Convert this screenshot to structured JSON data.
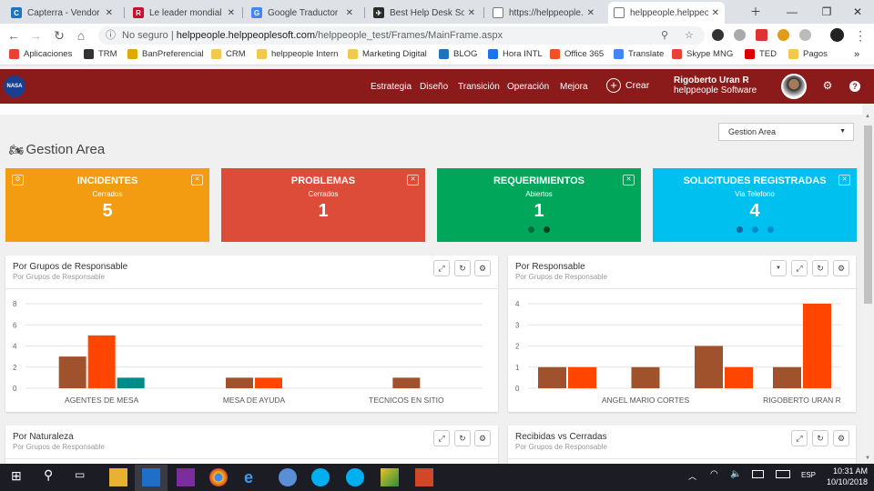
{
  "browser": {
    "tabs": [
      {
        "title": "Capterra - Vendor Po",
        "fav_color": "#1e73be",
        "fav_letter": "C"
      },
      {
        "title": "Le leader mondial de",
        "fav_color": "#c8102e",
        "fav_letter": "R"
      },
      {
        "title": "Google Traductor",
        "fav_color": "#4285f4",
        "fav_letter": "G"
      },
      {
        "title": "Best Help Desk Softw",
        "fav_color": "#2b2b2b",
        "fav_letter": "✈"
      },
      {
        "title": "https://helppeople.he",
        "fav_color": "#9e9e9e",
        "fav_letter": ""
      },
      {
        "title": "helppeople.helppeop",
        "fav_color": "#9e9e9e",
        "fav_letter": ""
      }
    ],
    "url_secure_label": "No seguro",
    "url_host": "helppeople.helppeoplesoft.com",
    "url_path": "/helppeople_test/Frames/MainFrame.aspx",
    "bookmarks": [
      "Aplicaciones",
      "TRM",
      "BanPreferencial",
      "CRM",
      "helppeople Intern",
      "Marketing Digital",
      "BLOG",
      "Hora INTL",
      "Office 365",
      "Translate",
      "Skype MNG",
      "TED",
      "Pagos"
    ]
  },
  "app": {
    "logo_text": "NASA",
    "menu": [
      "Estrategia",
      "Diseño",
      "Transición",
      "Operación",
      "Mejora"
    ],
    "create_label": "Crear",
    "user_name": "Rigoberto Uran R",
    "company": "helppeople Software"
  },
  "page": {
    "title": "Gestion Area",
    "area_select": "Gestion Area"
  },
  "cards": [
    {
      "title": "INCIDENTES",
      "subtitle": "Cerrados",
      "value": "5",
      "color": "#f39c12"
    },
    {
      "title": "PROBLEMAS",
      "subtitle": "Cerrados",
      "value": "1",
      "color": "#dd4b39"
    },
    {
      "title": "REQUERIMIENTOS",
      "subtitle": "Abiertos",
      "value": "1",
      "color": "#00a65a"
    },
    {
      "title": "SOLICITUDES REGISTRADAS",
      "subtitle": "Via Telefono",
      "value": "4",
      "color": "#00c0ef"
    }
  ],
  "panels": [
    {
      "title": "Por Grupos de Responsable",
      "subtitle": "Por Grupos de Responsable"
    },
    {
      "title": "Por Responsable",
      "subtitle": "Por Grupos de Responsable"
    },
    {
      "title": "Por Naturaleza",
      "subtitle": "Por Grupos de Responsable"
    },
    {
      "title": "Recibidas vs Cerradas",
      "subtitle": "Por Grupos de Responsable"
    }
  ],
  "chart_data": [
    {
      "type": "bar",
      "categories": [
        "AGENTES DE MESA",
        "MESA DE AYUDA",
        "TECNICOS EN SITIO"
      ],
      "series": [
        {
          "color": "#a0522d",
          "values": [
            3,
            1,
            1
          ]
        },
        {
          "color": "#ff4500",
          "values": [
            5,
            1,
            0
          ]
        },
        {
          "color": "#008b8b",
          "values": [
            1,
            0,
            0
          ]
        }
      ],
      "yticks": [
        0,
        2,
        4,
        6,
        8
      ],
      "ylim": [
        0,
        8
      ],
      "grid": true
    },
    {
      "type": "bar",
      "categories": [
        "ANGEL MARIO CORTES",
        "RIGOBERTO URAN R"
      ],
      "groups": [
        {
          "label": "",
          "values": [
            1,
            1
          ]
        },
        {
          "label": "ANGEL MARIO CORTES",
          "values": [
            1,
            0
          ]
        },
        {
          "label": "",
          "values": [
            2,
            1
          ]
        },
        {
          "label": "RIGOBERTO URAN R",
          "values": [
            1,
            4
          ]
        }
      ],
      "series_colors": [
        "#a0522d",
        "#ff4500"
      ],
      "yticks": [
        0,
        1,
        2,
        3,
        4
      ],
      "ylim": [
        0,
        4
      ],
      "grid": true
    }
  ],
  "taskbar": {
    "lang": "ESP",
    "time": "10:31 AM",
    "date": "10/10/2018"
  }
}
